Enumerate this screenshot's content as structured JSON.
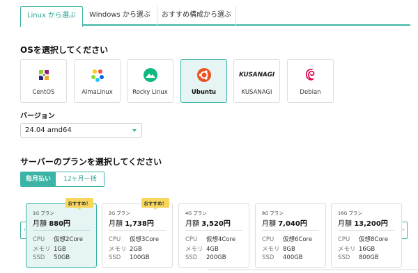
{
  "tabs": [
    {
      "label": "Linux から選ぶ",
      "active": true
    },
    {
      "label": "Windows から選ぶ",
      "active": false
    },
    {
      "label": "おすすめ構成から選ぶ",
      "active": false
    }
  ],
  "os_section": {
    "title": "OSを選択してください",
    "options": [
      {
        "name": "CentOS",
        "icon": "centos-logo-icon",
        "selected": false
      },
      {
        "name": "AlmaLinux",
        "icon": "almalinux-logo-icon",
        "selected": false
      },
      {
        "name": "Rocky Linux",
        "icon": "rocky-linux-logo-icon",
        "selected": false
      },
      {
        "name": "Ubuntu",
        "icon": "ubuntu-logo-icon",
        "selected": true
      },
      {
        "name": "KUSANAGI",
        "logo_text": "KUSANAGI",
        "icon": "kusanagi-logo-icon",
        "selected": false
      },
      {
        "name": "Debian",
        "icon": "debian-logo-icon",
        "selected": false
      }
    ]
  },
  "version": {
    "label": "バージョン",
    "value": "24.04 amd64"
  },
  "plan_section": {
    "title": "サーバーのプランを選択してください",
    "billing": {
      "monthly": "毎月払い",
      "yearly": "12ヶ月一括",
      "selected": "monthly"
    },
    "plans": [
      {
        "name": "1G プラン",
        "price_label": "月額",
        "price": "880円",
        "cpu": "仮想2Core",
        "memory": "1GB",
        "ssd": "50GB",
        "badge": "おすすめ！",
        "selected": true
      },
      {
        "name": "2G プラン",
        "price_label": "月額",
        "price": "1,738円",
        "cpu": "仮想3Core",
        "memory": "2GB",
        "ssd": "100GB",
        "badge": "おすすめ！",
        "selected": false
      },
      {
        "name": "4G プラン",
        "price_label": "月額",
        "price": "3,520円",
        "cpu": "仮想4Core",
        "memory": "4GB",
        "ssd": "200GB",
        "badge": "",
        "selected": false
      },
      {
        "name": "8G プラン",
        "price_label": "月額",
        "price": "7,040円",
        "cpu": "仮想6Core",
        "memory": "8GB",
        "ssd": "400GB",
        "badge": "",
        "selected": false
      },
      {
        "name": "16G プラン",
        "price_label": "月額",
        "price": "13,200円",
        "cpu": "仮想8Core",
        "memory": "16GB",
        "ssd": "800GB",
        "badge": "",
        "selected": false
      }
    ],
    "spec_labels": {
      "cpu": "CPU",
      "memory": "メモリ",
      "ssd": "SSD"
    },
    "prev_arrow": "‹",
    "next_arrow": "›"
  },
  "colors": {
    "accent": "#3bb3a5",
    "selected_bg": "#e6f5f3",
    "badge": "#f6d65c"
  }
}
